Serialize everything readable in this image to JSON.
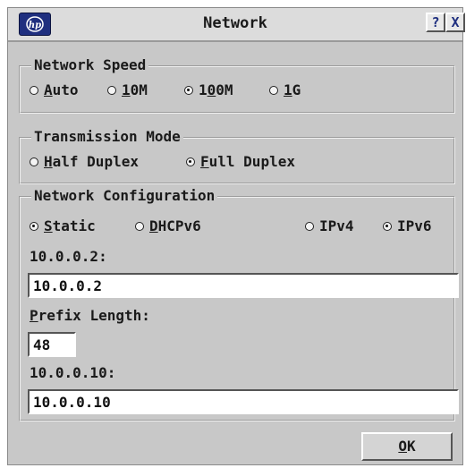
{
  "window": {
    "title": "Network",
    "help_glyph": "?",
    "close_glyph": "X",
    "logo_text": "hp"
  },
  "network_speed": {
    "title": "Network Speed",
    "options": [
      {
        "label_first": "A",
        "label_rest": "uto",
        "selected": false
      },
      {
        "label_first": "1",
        "label_rest": "0M",
        "selected": false
      },
      {
        "label_first": "1",
        "label_rest": "00M",
        "underline_index": 2,
        "selected": true
      },
      {
        "label_first": "1",
        "label_rest": "G",
        "selected": false
      }
    ]
  },
  "transmission_mode": {
    "title": "Transmission Mode",
    "options": [
      {
        "label_first": "H",
        "label_rest": "alf Duplex",
        "selected": false
      },
      {
        "label_first": "F",
        "label_rest": "ull Duplex",
        "selected": true
      }
    ]
  },
  "network_configuration": {
    "title": "Network Configuration",
    "mode_options": [
      {
        "label_first": "S",
        "label_rest": "tatic",
        "selected": true
      },
      {
        "label_first": "D",
        "label_rest": "HCPv6",
        "selected": false
      }
    ],
    "ip_options": [
      {
        "label": "IPv4",
        "selected": false
      },
      {
        "label": "IPv6",
        "selected": true
      }
    ],
    "address_label": "10.0.0.2:",
    "address_value": "10.0.0.2",
    "prefix_label_first": "P",
    "prefix_label_rest": "refix Length:",
    "prefix_value": "48",
    "gateway_label": "10.0.0.10:",
    "gateway_value": "10.0.0.10"
  },
  "ok_button": {
    "label_first": "O",
    "label_rest": "K"
  },
  "colors": {
    "window_bg": "#c8c8c8",
    "logo_bg": "#1f2f7f",
    "field_bg": "#ffffff"
  }
}
